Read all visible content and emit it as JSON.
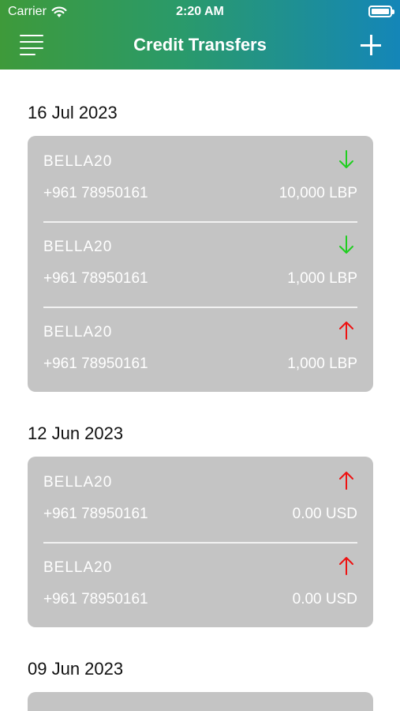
{
  "status_bar": {
    "carrier": "Carrier",
    "time": "2:20 AM"
  },
  "nav": {
    "title": "Credit Transfers"
  },
  "colors": {
    "incoming": "#1fcf1f",
    "outgoing": "#ee1111",
    "card": "#c4c4c4"
  },
  "groups": [
    {
      "date": "16 Jul 2023",
      "transfers": [
        {
          "name": "BELLA20",
          "phone": "+961 78950161",
          "amount": "10,000 LBP",
          "direction": "in",
          "icon": "arrow-down-icon"
        },
        {
          "name": "BELLA20",
          "phone": "+961 78950161",
          "amount": "1,000 LBP",
          "direction": "in",
          "icon": "arrow-down-icon"
        },
        {
          "name": "BELLA20",
          "phone": "+961 78950161",
          "amount": "1,000 LBP",
          "direction": "out",
          "icon": "arrow-up-icon"
        }
      ]
    },
    {
      "date": "12 Jun 2023",
      "transfers": [
        {
          "name": "BELLA20",
          "phone": "+961 78950161",
          "amount": "0.00 USD",
          "direction": "out",
          "icon": "arrow-up-icon"
        },
        {
          "name": "BELLA20",
          "phone": "+961 78950161",
          "amount": "0.00 USD",
          "direction": "out",
          "icon": "arrow-up-icon"
        }
      ]
    },
    {
      "date": "09 Jun 2023",
      "transfers": []
    }
  ]
}
